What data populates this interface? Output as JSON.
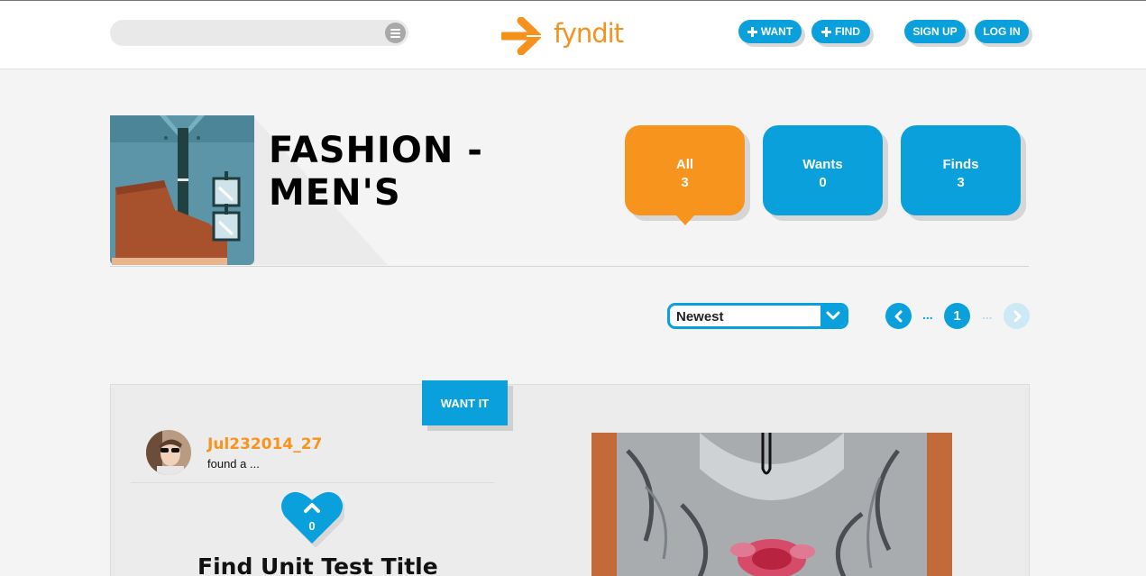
{
  "header": {
    "search_placeholder": "",
    "brand": "fyndit",
    "want_label": "WANT",
    "find_label": "FIND",
    "signup_label": "SIGN UP",
    "login_label": "LOG IN"
  },
  "category": {
    "title_line1": "FASHION -",
    "title_line2": "MEN'S"
  },
  "filters": [
    {
      "label": "All",
      "count": "3",
      "active": true
    },
    {
      "label": "Wants",
      "count": "0",
      "active": false
    },
    {
      "label": "Finds",
      "count": "3",
      "active": false
    }
  ],
  "sort": {
    "selected": "Newest"
  },
  "pagination": {
    "dots_left": "...",
    "current_page": "1",
    "dots_right": "..."
  },
  "card": {
    "badge": "WANT IT",
    "username": "Jul232014_27",
    "action_text": "found a ...",
    "like_count": "0",
    "title": "Find Unit Test Title"
  },
  "colors": {
    "brand_orange": "#f7941d",
    "brand_blue": "#0aa0dc",
    "background": "#f4f4f4"
  },
  "icons": [
    "menu-icon",
    "fyndit-logo-arrow-icon",
    "plus-icon",
    "chevron-left-icon",
    "chevron-right-icon",
    "chevron-down-icon",
    "heart-icon",
    "chevron-up-icon"
  ]
}
